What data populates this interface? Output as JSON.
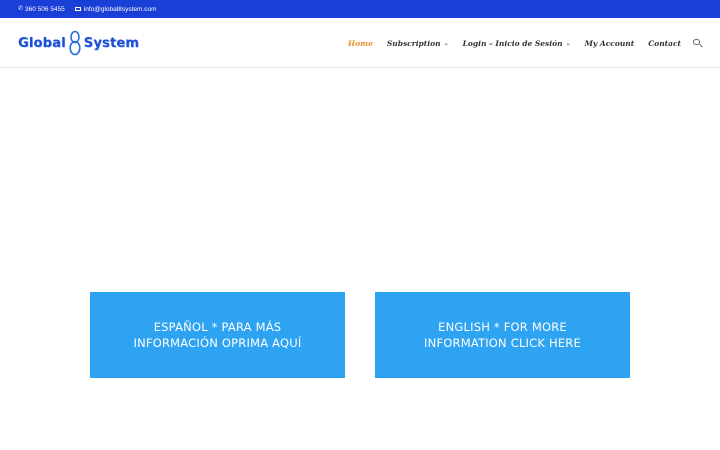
{
  "topbar": {
    "phone": "360 506 5455",
    "email": "info@global8system.com"
  },
  "logo": {
    "word1": "Global",
    "word2": "System"
  },
  "nav": {
    "items": [
      {
        "label": "Home",
        "active": true
      },
      {
        "label": "Subscription",
        "has_dropdown": true
      },
      {
        "label": "Login – Inicio de Sesión",
        "has_dropdown": true
      },
      {
        "label": "My Account"
      },
      {
        "label": "Contact"
      }
    ]
  },
  "cta": {
    "spanish": "ESPAÑOL * PARA MÁS INFORMACIÓN OPRIMA AQUÍ",
    "english": "ENGLISH * FOR MORE INFORMATION CLICK HERE"
  },
  "colors": {
    "topbar": "#1a3fd6",
    "accent_active": "#e8902a",
    "cta": "#2ea3f2"
  }
}
